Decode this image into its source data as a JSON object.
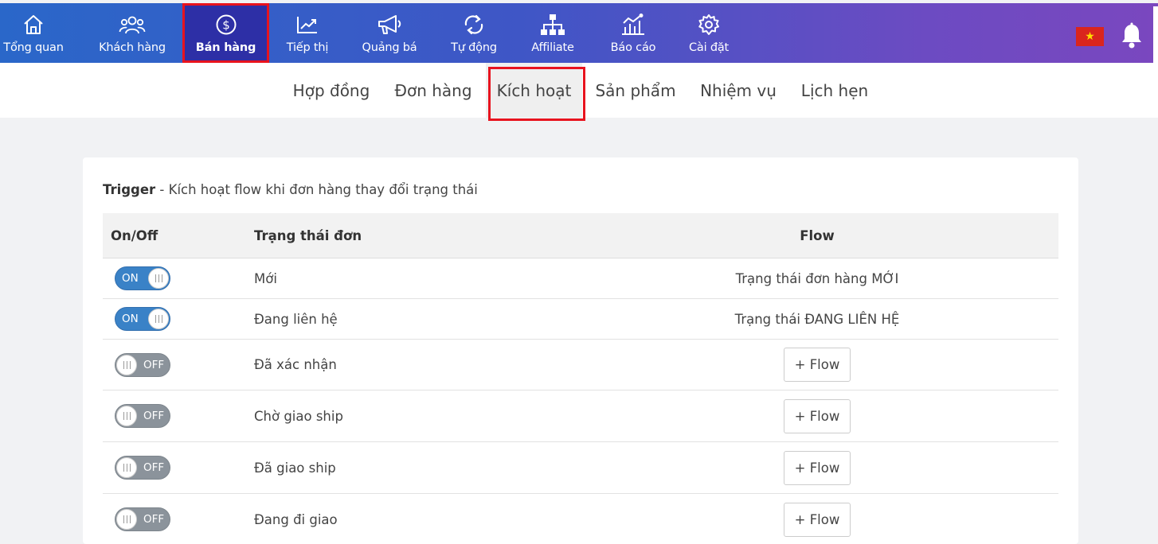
{
  "topnav": {
    "items": [
      {
        "label": "Tổng quan",
        "icon": "home-icon"
      },
      {
        "label": "Khách hàng",
        "icon": "users-icon"
      },
      {
        "label": "Bán hàng",
        "icon": "dollar-circle-icon",
        "active": true
      },
      {
        "label": "Tiếp thị",
        "icon": "trend-chart-icon"
      },
      {
        "label": "Quảng bá",
        "icon": "megaphone-icon"
      },
      {
        "label": "Tự động",
        "icon": "sync-icon"
      },
      {
        "label": "Affiliate",
        "icon": "sitemap-icon"
      },
      {
        "label": "Báo cáo",
        "icon": "report-chart-icon"
      },
      {
        "label": "Cài đặt",
        "icon": "gear-icon"
      }
    ],
    "flag_icon": "vietnam-flag-icon",
    "bell_icon": "bell-icon"
  },
  "subnav": {
    "items": [
      {
        "label": "Hợp đồng"
      },
      {
        "label": "Đơn hàng"
      },
      {
        "label": "Kích hoạt",
        "active": true
      },
      {
        "label": "Sản phẩm"
      },
      {
        "label": "Nhiệm vụ"
      },
      {
        "label": "Lịch hẹn"
      }
    ]
  },
  "trigger": {
    "title_bold": "Trigger",
    "title_rest": " - Kích hoạt flow khi đơn hàng thay đổi trạng thái"
  },
  "table": {
    "headers": {
      "onoff": "On/Off",
      "status": "Trạng thái đơn",
      "flow": "Flow"
    },
    "rows": [
      {
        "toggle": "ON",
        "status": "Mới",
        "flow": "Trạng thái đơn hàng MỚI"
      },
      {
        "toggle": "ON",
        "status": "Đang liên hệ",
        "flow": "Trạng thái ĐANG LIÊN HỆ"
      },
      {
        "toggle": "OFF",
        "status": "Đã xác nhận",
        "flow_button": "+ Flow"
      },
      {
        "toggle": "OFF",
        "status": "Chờ giao ship",
        "flow_button": "+ Flow"
      },
      {
        "toggle": "OFF",
        "status": "Đã giao ship",
        "flow_button": "+ Flow"
      },
      {
        "toggle": "OFF",
        "status": "Đang đi giao",
        "flow_button": "+ Flow"
      }
    ]
  },
  "colors": {
    "nav_gradient_start": "#2a67c9",
    "nav_gradient_end": "#7a47bf",
    "highlight_red": "#e8131e",
    "toggle_on": "#3a82c7",
    "toggle_off": "#8b939b"
  }
}
